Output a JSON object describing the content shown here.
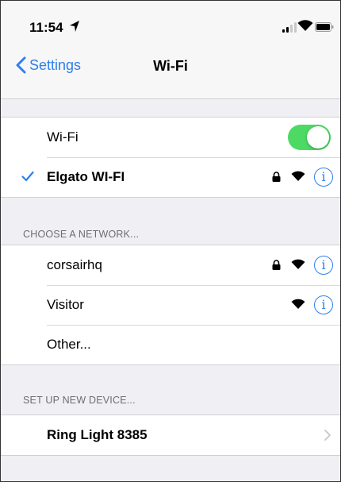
{
  "status_bar": {
    "time": "11:54"
  },
  "nav": {
    "back_label": "Settings",
    "title": "Wi-Fi"
  },
  "wifi_toggle": {
    "label": "Wi-Fi",
    "on": true
  },
  "connected": {
    "name": "Elgato WI-FI",
    "secured": true
  },
  "choose_network": {
    "header": "CHOOSE A NETWORK...",
    "networks": [
      {
        "name": "corsairhq",
        "secured": true
      },
      {
        "name": "Visitor",
        "secured": false
      },
      {
        "name": "Other..."
      }
    ]
  },
  "new_device": {
    "header": "SET UP NEW DEVICE...",
    "device": "Ring Light 8385"
  },
  "icons": {
    "check": "checkmark-icon",
    "lock": "lock-icon",
    "wifi": "wifi-icon",
    "info": "info-icon",
    "chevron": "chevron-right-icon",
    "back": "chevron-left-icon"
  },
  "colors": {
    "accent": "#2f80ed",
    "toggle_on": "#4cd964",
    "background": "#efeff4"
  }
}
